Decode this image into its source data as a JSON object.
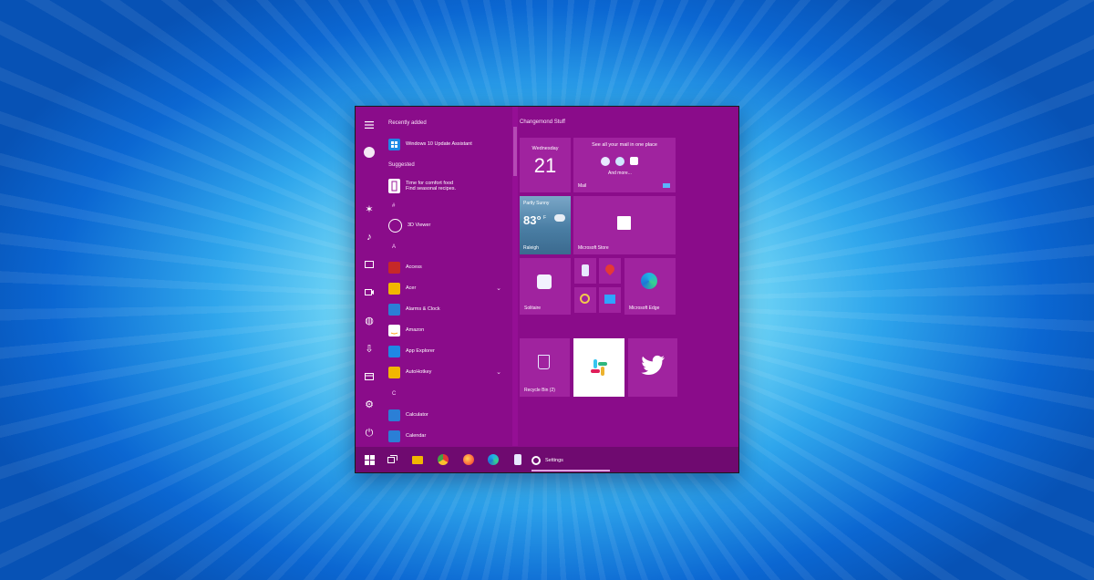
{
  "rail": {
    "icons": [
      "menu-icon",
      "user-icon",
      "settings-icon",
      "music-icon",
      "pictures-icon",
      "videos-icon",
      "network-icon",
      "downloads-icon",
      "file-explorer-icon",
      "gear-icon",
      "power-icon"
    ]
  },
  "applist": {
    "recently_added_label": "Recently added",
    "recent": [
      {
        "label": "Windows 10 Update Assistant",
        "icon": "windows-update-icon",
        "color": "#1e88e5"
      }
    ],
    "suggested_label": "Suggested",
    "suggested": {
      "line1": "Time for comfort food",
      "line2": "Find seasonal recipes.",
      "icon": "recipe-icon"
    },
    "sections": [
      {
        "letter": "#",
        "apps": [
          {
            "label": "3D Viewer",
            "icon": "3d-viewer-icon",
            "color": "#9b1c9b"
          }
        ]
      },
      {
        "letter": "A",
        "apps": [
          {
            "label": "Access",
            "icon": "access-icon",
            "color": "#c62828"
          },
          {
            "label": "Acer",
            "icon": "folder-icon",
            "color": "#f2b600",
            "expand": true
          },
          {
            "label": "Alarms & Clock",
            "icon": "alarm-icon",
            "color": "#2b7fd6"
          },
          {
            "label": "Amazon",
            "icon": "amazon-icon",
            "color": "#ffffff"
          },
          {
            "label": "App Explorer",
            "icon": "app-explorer-icon",
            "color": "#1e88e5"
          },
          {
            "label": "AutoHotkey",
            "icon": "folder-icon",
            "color": "#f2b600",
            "expand": true
          }
        ]
      },
      {
        "letter": "C",
        "apps": [
          {
            "label": "Calculator",
            "icon": "calculator-icon",
            "color": "#2b7fd6"
          },
          {
            "label": "Calendar",
            "icon": "calendar-icon",
            "color": "#2b7fd6"
          }
        ]
      }
    ]
  },
  "tiles": {
    "group_title": "Changemond Stuff",
    "calendar": {
      "day": "Wednesday",
      "date": "21"
    },
    "mail": {
      "headline": "See all your mail in one place",
      "more": "And more...",
      "label": "Mail"
    },
    "weather": {
      "condition": "Partly Sunny",
      "temp": "83°",
      "unit": "F",
      "location": "Raleigh"
    },
    "store": {
      "label": "Microsoft Store"
    },
    "solitaire": {
      "label": "Solitaire"
    },
    "edge": {
      "label": "Microsoft Edge"
    },
    "recycle": {
      "label": "Recycle Bin (2)"
    },
    "slack": {
      "icon": "slack-icon"
    },
    "twitter": {
      "icon": "twitter-icon"
    }
  },
  "taskbar": {
    "items": [
      "windows-start-icon",
      "task-view-icon",
      "file-explorer-icon",
      "chrome-icon",
      "firefox-icon",
      "edge-icon",
      "phone-icon"
    ],
    "settings_label": "Settings"
  }
}
